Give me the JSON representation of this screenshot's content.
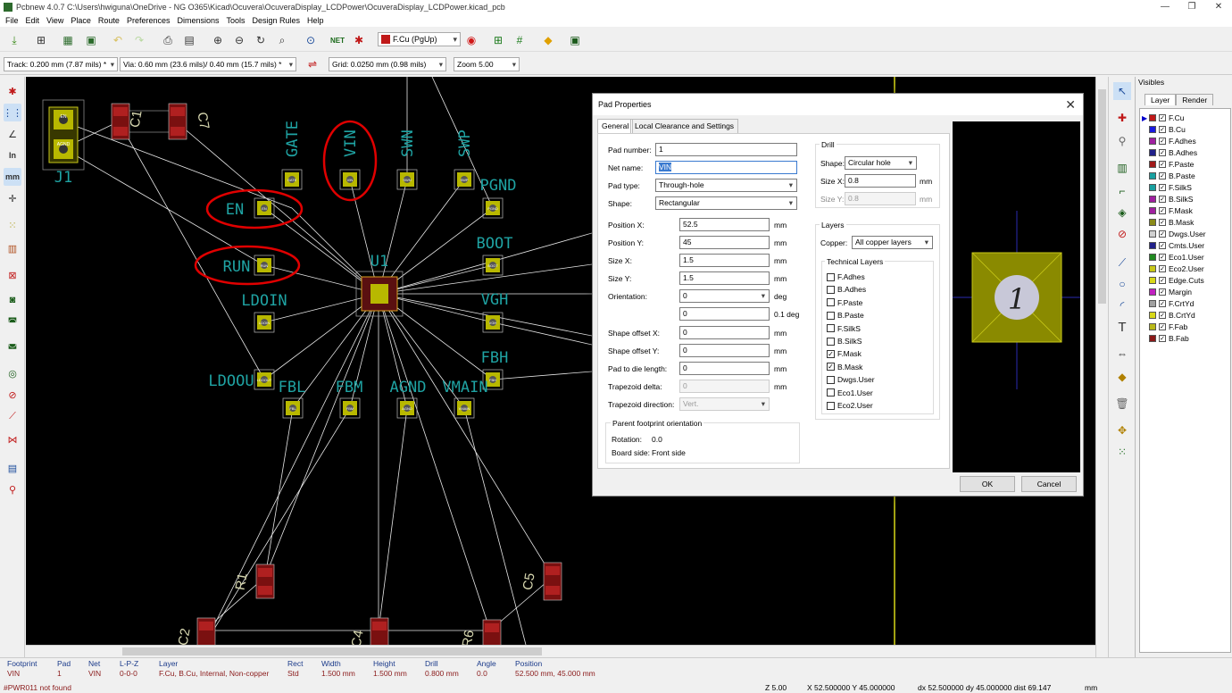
{
  "window": {
    "title": "Pcbnew 4.0.7 C:\\Users\\hwiguna\\OneDrive - NG O365\\Kicad\\Ocuvera\\OcuveraDisplay_LCDPower\\OcuveraDisplay_LCDPower.kicad_pcb",
    "controls": [
      "—",
      "❐",
      "✕"
    ]
  },
  "menu": [
    "File",
    "Edit",
    "View",
    "Place",
    "Route",
    "Preferences",
    "Dimensions",
    "Tools",
    "Design Rules",
    "Help"
  ],
  "toolbar": {
    "active_layer": "F.Cu (PgUp)",
    "track": "Track: 0.200 mm (7.87 mils) *",
    "via": "Via: 0.60 mm (23.6 mils)/ 0.40 mm (15.7 mils) *",
    "grid": "Grid: 0.0250 mm (0.98 mils)",
    "zoom": "Zoom 5.00"
  },
  "pcb": {
    "components": [
      "J1",
      "C1",
      "C7",
      "U1",
      "R1",
      "C2",
      "C4",
      "R6",
      "C5"
    ],
    "nets": [
      "GATE",
      "VIN",
      "SWN",
      "SWP",
      "PGND",
      "EN",
      "BOOT",
      "RUN",
      "LDOIN",
      "VGH",
      "FBH",
      "LDOOUT",
      "FBL",
      "FBM",
      "AGND",
      "VMAIN"
    ],
    "display_labels": {
      "LDOOUT": "LDOOU"
    },
    "pad_labels": {
      "J1": [
        "EN",
        "AGND"
      ],
      "GATE": "GATE",
      "VIN": "VIN",
      "SWN": "SWN",
      "SWP": "SWP",
      "PGND": "PGND",
      "EN": "EN",
      "BOOT": "BOOT",
      "RUN": "RUN",
      "LDOIN": "LDOIN",
      "VGH": "VGH",
      "FBH": "FBH",
      "LDOOUT": "LDOOUT",
      "FBL": "FBL",
      "FBM": "FBM",
      "AGND": "AGND",
      "VMAIN": "VMAIN"
    },
    "highlight_color": "#e00000",
    "label_color": "#1fa3a3",
    "pad_color": "#b8b800"
  },
  "dialog": {
    "title": "Pad Properties",
    "tabs": [
      "General",
      "Local Clearance and Settings"
    ],
    "fields": {
      "pad_number": {
        "label": "Pad number:",
        "value": "1"
      },
      "net_name": {
        "label": "Net name:",
        "value": "VIN"
      },
      "pad_type": {
        "label": "Pad type:",
        "value": "Through-hole"
      },
      "shape": {
        "label": "Shape:",
        "value": "Rectangular"
      },
      "position_x": {
        "label": "Position X:",
        "value": "52.5",
        "unit": "mm"
      },
      "position_y": {
        "label": "Position Y:",
        "value": "45",
        "unit": "mm"
      },
      "size_x": {
        "label": "Size X:",
        "value": "1.5",
        "unit": "mm"
      },
      "size_y": {
        "label": "Size Y:",
        "value": "1.5",
        "unit": "mm"
      },
      "orientation": {
        "label": "Orientation:",
        "value": "0",
        "unit": "deg"
      },
      "orientation_fine": {
        "value": "0",
        "unit": "0.1 deg"
      },
      "shape_offset_x": {
        "label": "Shape offset X:",
        "value": "0",
        "unit": "mm"
      },
      "shape_offset_y": {
        "label": "Shape offset Y:",
        "value": "0",
        "unit": "mm"
      },
      "pad_to_die": {
        "label": "Pad to die length:",
        "value": "0",
        "unit": "mm"
      },
      "trapezoid_delta": {
        "label": "Trapezoid delta:",
        "value": "0",
        "unit": "mm"
      },
      "trapezoid_direction": {
        "label": "Trapezoid direction:",
        "value": "Vert."
      }
    },
    "parent": {
      "title": "Parent footprint orientation",
      "rotation_label": "Rotation:",
      "rotation": "0.0",
      "side_label": "Board side:",
      "side": "Front side"
    },
    "drill": {
      "title": "Drill",
      "shape_label": "Shape:",
      "shape": "Circular hole",
      "size_x_label": "Size X:",
      "size_x": "0.8",
      "size_y_label": "Size Y:",
      "size_y": "0.8",
      "unit": "mm"
    },
    "layers": {
      "title": "Layers",
      "copper_label": "Copper:",
      "copper": "All copper layers",
      "technical_title": "Technical Layers",
      "technical": [
        {
          "name": "F.Adhes",
          "checked": false
        },
        {
          "name": "B.Adhes",
          "checked": false
        },
        {
          "name": "F.Paste",
          "checked": false
        },
        {
          "name": "B.Paste",
          "checked": false
        },
        {
          "name": "F.SilkS",
          "checked": false
        },
        {
          "name": "B.SilkS",
          "checked": false
        },
        {
          "name": "F.Mask",
          "checked": true
        },
        {
          "name": "B.Mask",
          "checked": true
        },
        {
          "name": "Dwgs.User",
          "checked": false
        },
        {
          "name": "Eco1.User",
          "checked": false
        },
        {
          "name": "Eco2.User",
          "checked": false
        }
      ]
    },
    "preview_pad_number": "1",
    "ok": "OK",
    "cancel": "Cancel"
  },
  "visibles": {
    "title": "Visibles",
    "tabs": [
      "Layer",
      "Render"
    ],
    "layers": [
      {
        "name": "F.Cu",
        "color": "#c01818",
        "checked": true,
        "current": true
      },
      {
        "name": "B.Cu",
        "color": "#1a1ae0",
        "checked": true
      },
      {
        "name": "F.Adhes",
        "color": "#a020a0",
        "checked": true
      },
      {
        "name": "B.Adhes",
        "color": "#20208a",
        "checked": true
      },
      {
        "name": "F.Paste",
        "color": "#a01818",
        "checked": true
      },
      {
        "name": "B.Paste",
        "color": "#18a0a0",
        "checked": true
      },
      {
        "name": "F.SilkS",
        "color": "#18a0a0",
        "checked": true
      },
      {
        "name": "B.SilkS",
        "color": "#a020a0",
        "checked": true
      },
      {
        "name": "F.Mask",
        "color": "#a020a0",
        "checked": true
      },
      {
        "name": "B.Mask",
        "color": "#8a8a18",
        "checked": true
      },
      {
        "name": "Dwgs.User",
        "color": "#d0d0d0",
        "checked": true
      },
      {
        "name": "Cmts.User",
        "color": "#20208a",
        "checked": true
      },
      {
        "name": "Eco1.User",
        "color": "#208a20",
        "checked": true
      },
      {
        "name": "Eco2.User",
        "color": "#c8c818",
        "checked": true
      },
      {
        "name": "Edge.Cuts",
        "color": "#d8d818",
        "checked": true
      },
      {
        "name": "Margin",
        "color": "#c020c0",
        "checked": true
      },
      {
        "name": "F.CrtYd",
        "color": "#a0a0a0",
        "checked": true
      },
      {
        "name": "B.CrtYd",
        "color": "#d8d818",
        "checked": true
      },
      {
        "name": "F.Fab",
        "color": "#b8b818",
        "checked": true
      },
      {
        "name": "B.Fab",
        "color": "#8a1818",
        "checked": true
      }
    ]
  },
  "status": {
    "headers": [
      "Footprint",
      "Pad",
      "Net",
      "L-P-Z",
      "Layer",
      "Rect",
      "Width",
      "Height",
      "Drill",
      "Angle",
      "Position"
    ],
    "values": [
      "VIN",
      "1",
      "VIN",
      "0-0-0",
      "F.Cu, B.Cu, Internal, Non-copper",
      "Std",
      "1.500 mm",
      "1.500 mm",
      "0.800 mm",
      "0.0",
      "52.500 mm, 45.000 mm"
    ],
    "message": "#PWR011 not found",
    "zoom": "Z 5.00",
    "xy": "X 52.500000  Y 45.000000",
    "delta": "dx 52.500000  dy 45.000000  dist 69.147",
    "units": "mm"
  }
}
